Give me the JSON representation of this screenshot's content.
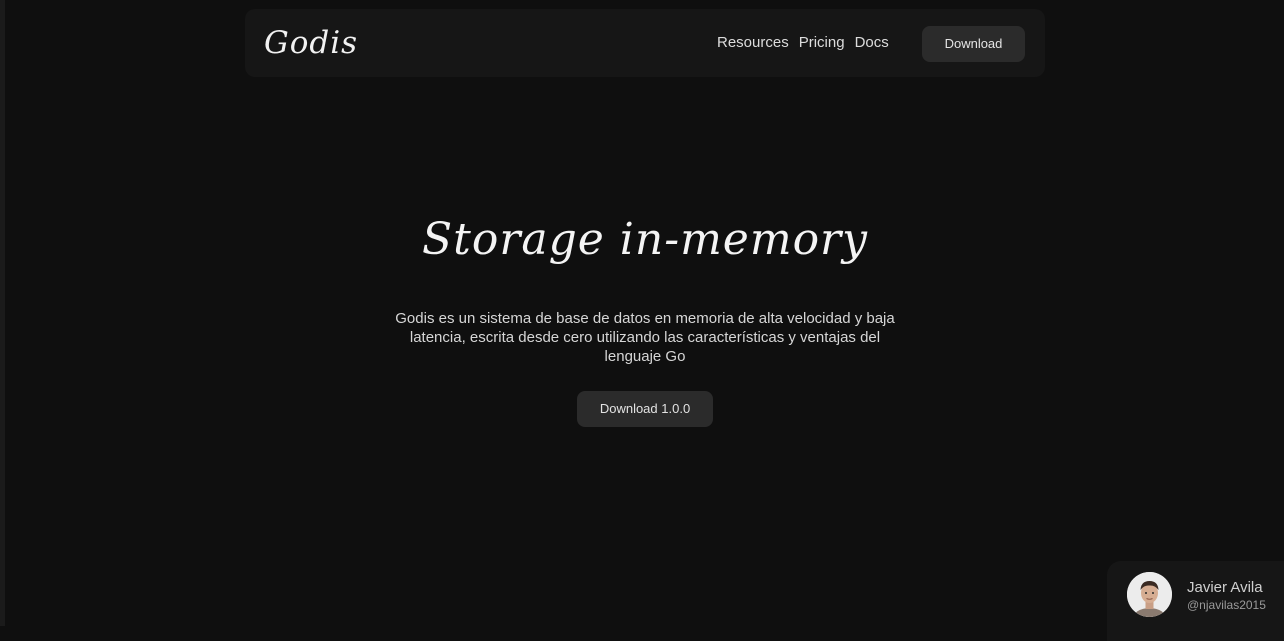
{
  "navbar": {
    "logo": "Godis",
    "links": [
      "Resources",
      "Pricing",
      "Docs"
    ],
    "download_label": "Download"
  },
  "hero": {
    "title": "Storage in-memory",
    "description": "Godis es un sistema de base de datos en memoria de alta velocidad y baja latencia, escrita desde cero utilizando las características y ventajas del lenguaje Go",
    "download_label": "Download 1.0.0"
  },
  "author": {
    "name": "Javier Avila",
    "handle": "@njavilas2015"
  },
  "colors": {
    "background": "#0f0f0f",
    "surface": "#161616",
    "button": "#2b2b2b",
    "text": "#e8e8e8"
  }
}
